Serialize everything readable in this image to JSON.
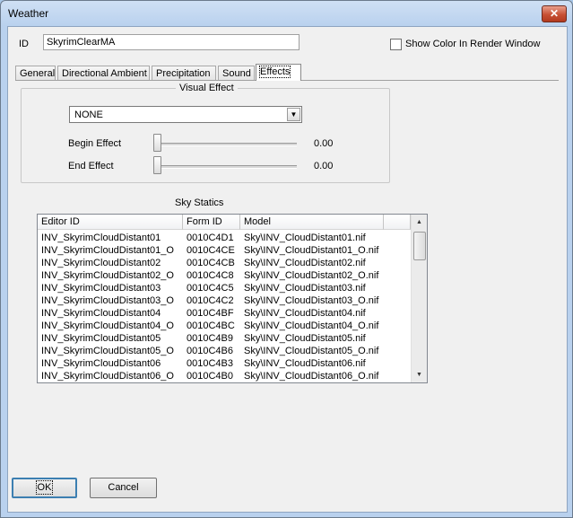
{
  "window": {
    "title": "Weather",
    "close_symbol": "✕"
  },
  "id_field": {
    "label": "ID",
    "value": "SkyrimClearMA"
  },
  "show_color": {
    "label": "Show Color In Render Window",
    "checked": false
  },
  "tabs": [
    {
      "label": "General",
      "active": false
    },
    {
      "label": "Directional Ambient",
      "active": false
    },
    {
      "label": "Precipitation",
      "active": false
    },
    {
      "label": "Sound",
      "active": false
    },
    {
      "label": "Effects",
      "active": true
    }
  ],
  "visual_effect": {
    "group_title": "Visual Effect",
    "selected": "NONE",
    "begin_label": "Begin Effect",
    "begin_value": "0.00",
    "end_label": "End Effect",
    "end_value": "0.00"
  },
  "sky_statics": {
    "title": "Sky Statics",
    "columns": [
      "Editor ID",
      "Form ID",
      "Model"
    ],
    "rows": [
      [
        "INV_SkyrimCloudDistant01",
        "0010C4D1",
        "Sky\\INV_CloudDistant01.nif"
      ],
      [
        "INV_SkyrimCloudDistant01_O",
        "0010C4CE",
        "Sky\\INV_CloudDistant01_O.nif"
      ],
      [
        "INV_SkyrimCloudDistant02",
        "0010C4CB",
        "Sky\\INV_CloudDistant02.nif"
      ],
      [
        "INV_SkyrimCloudDistant02_O",
        "0010C4C8",
        "Sky\\INV_CloudDistant02_O.nif"
      ],
      [
        "INV_SkyrimCloudDistant03",
        "0010C4C5",
        "Sky\\INV_CloudDistant03.nif"
      ],
      [
        "INV_SkyrimCloudDistant03_O",
        "0010C4C2",
        "Sky\\INV_CloudDistant03_O.nif"
      ],
      [
        "INV_SkyrimCloudDistant04",
        "0010C4BF",
        "Sky\\INV_CloudDistant04.nif"
      ],
      [
        "INV_SkyrimCloudDistant04_O",
        "0010C4BC",
        "Sky\\INV_CloudDistant04_O.nif"
      ],
      [
        "INV_SkyrimCloudDistant05",
        "0010C4B9",
        "Sky\\INV_CloudDistant05.nif"
      ],
      [
        "INV_SkyrimCloudDistant05_O",
        "0010C4B6",
        "Sky\\INV_CloudDistant05_O.nif"
      ],
      [
        "INV_SkyrimCloudDistant06",
        "0010C4B3",
        "Sky\\INV_CloudDistant06.nif"
      ],
      [
        "INV_SkyrimCloudDistant06_O",
        "0010C4B0",
        "Sky\\INV_CloudDistant06_O.nif"
      ]
    ]
  },
  "buttons": {
    "ok": "OK",
    "cancel": "Cancel"
  },
  "icons": {
    "close": "close-icon",
    "dropdown": "chevron-down-icon",
    "scroll_up": "scroll-up-icon",
    "scroll_down": "scroll-down-icon"
  }
}
